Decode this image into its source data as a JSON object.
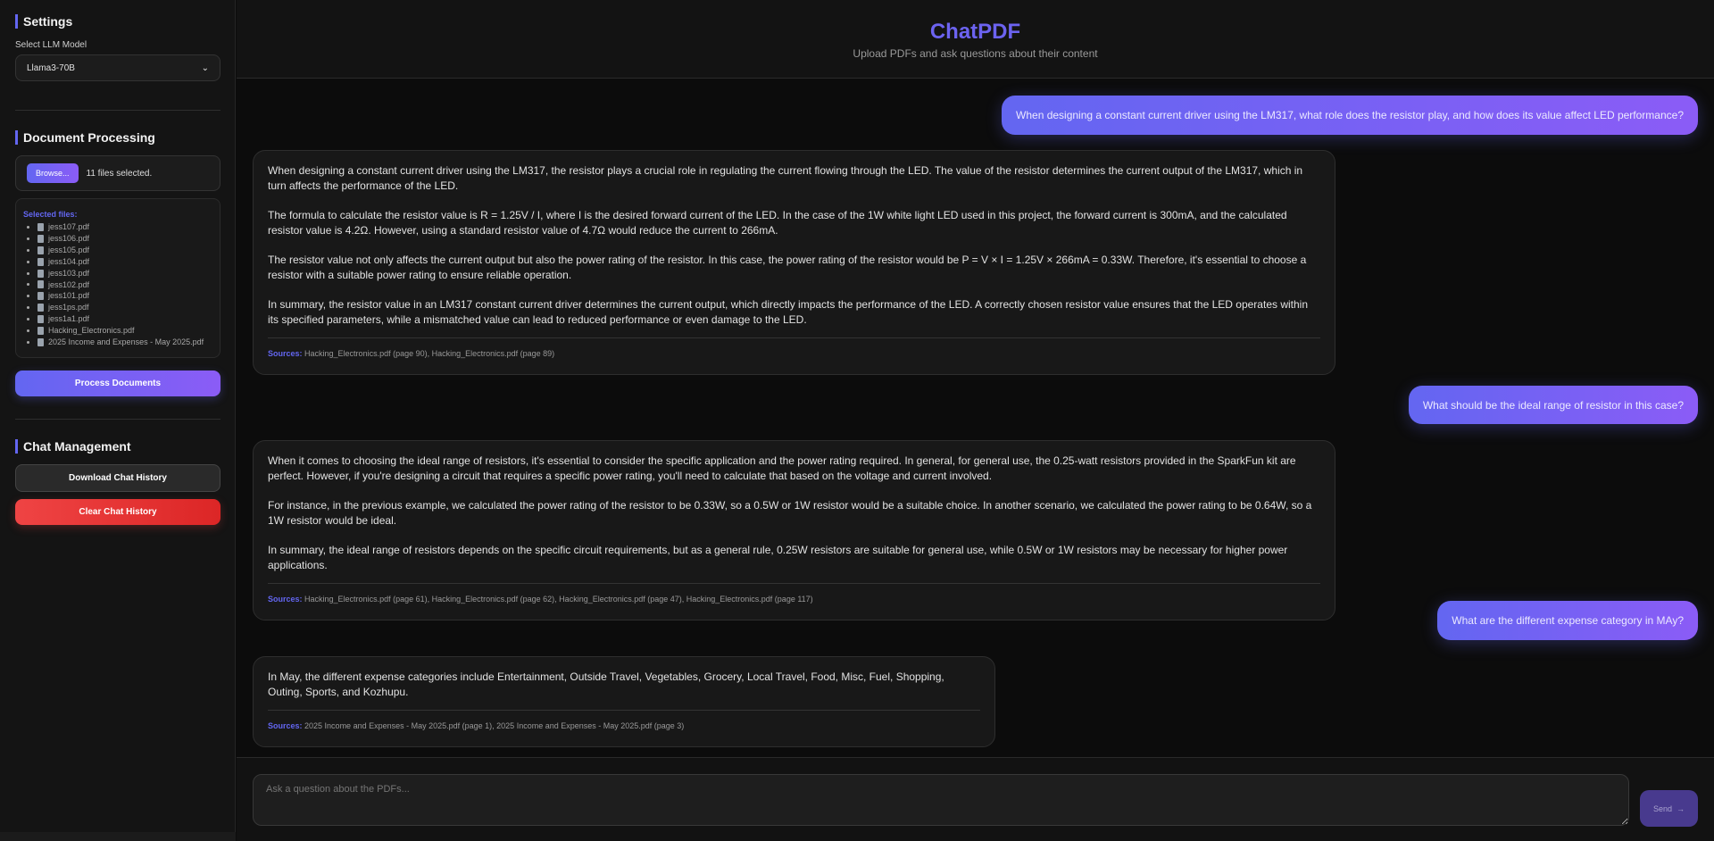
{
  "sidebar": {
    "settings_title": "Settings",
    "model_label": "Select LLM Model",
    "model_value": "Llama3-70B",
    "doc_title": "Document Processing",
    "browse_label": "Browse...",
    "file_count": "11 files selected.",
    "selected_files_label": "Selected files:",
    "files": [
      "jess107.pdf",
      "jess106.pdf",
      "jess105.pdf",
      "jess104.pdf",
      "jess103.pdf",
      "jess102.pdf",
      "jess101.pdf",
      "jess1ps.pdf",
      "jess1a1.pdf",
      "Hacking_Electronics.pdf",
      "2025 Income and Expenses - May 2025.pdf"
    ],
    "process_label": "Process Documents",
    "chat_title": "Chat Management",
    "download_label": "Download Chat History",
    "clear_label": "Clear Chat History"
  },
  "header": {
    "title": "ChatPDF",
    "subtitle": "Upload PDFs and ask questions about their content"
  },
  "messages": [
    {
      "user": "When designing a constant current driver using the LM317, what role does the resistor play, and how does its value affect LED performance?",
      "paragraphs": [
        "When designing a constant current driver using the LM317, the resistor plays a crucial role in regulating the current flowing through the LED. The value of the resistor determines the current output of the LM317, which in turn affects the performance of the LED.",
        "The formula to calculate the resistor value is R = 1.25V / I, where I is the desired forward current of the LED. In the case of the 1W white light LED used in this project, the forward current is 300mA, and the calculated resistor value is 4.2Ω. However, using a standard resistor value of 4.7Ω would reduce the current to 266mA.",
        "The resistor value not only affects the current output but also the power rating of the resistor. In this case, the power rating of the resistor would be P = V × I = 1.25V × 266mA = 0.33W. Therefore, it's essential to choose a resistor with a suitable power rating to ensure reliable operation.",
        "In summary, the resistor value in an LM317 constant current driver determines the current output, which directly impacts the performance of the LED. A correctly chosen resistor value ensures that the LED operates within its specified parameters, while a mismatched value can lead to reduced performance or even damage to the LED."
      ],
      "sources": "Hacking_Electronics.pdf (page 90), Hacking_Electronics.pdf (page 89)"
    },
    {
      "user": "What should be the ideal range of resistor in this case?",
      "paragraphs": [
        "When it comes to choosing the ideal range of resistors, it's essential to consider the specific application and the power rating required. In general, for general use, the 0.25-watt resistors provided in the SparkFun kit are perfect. However, if you're designing a circuit that requires a specific power rating, you'll need to calculate that based on the voltage and current involved.",
        "For instance, in the previous example, we calculated the power rating of the resistor to be 0.33W, so a 0.5W or 1W resistor would be a suitable choice. In another scenario, we calculated the power rating to be 0.64W, so a 1W resistor would be ideal.",
        "In summary, the ideal range of resistors depends on the specific circuit requirements, but as a general rule, 0.25W resistors are suitable for general use, while 0.5W or 1W resistors may be necessary for higher power applications."
      ],
      "sources": "Hacking_Electronics.pdf (page 61), Hacking_Electronics.pdf (page 62), Hacking_Electronics.pdf (page 47), Hacking_Electronics.pdf (page 117)"
    },
    {
      "user": "What are the different expense category in MAy?",
      "paragraphs": [
        "In May, the different expense categories include Entertainment, Outside Travel, Vegetables, Grocery, Local Travel, Food, Misc, Fuel, Shopping, Outing, Sports, and Kozhupu."
      ],
      "sources": "2025 Income and Expenses - May 2025.pdf (page 1), 2025 Income and Expenses - May 2025.pdf (page 3)"
    }
  ],
  "sources_label": "Sources:",
  "input": {
    "placeholder": "Ask a question about the PDFs...",
    "send_label": "Send",
    "send_icon": "→"
  },
  "colors": {
    "accent": "#6366f1",
    "accent2": "#8b5cf6",
    "danger": "#ef4444"
  }
}
